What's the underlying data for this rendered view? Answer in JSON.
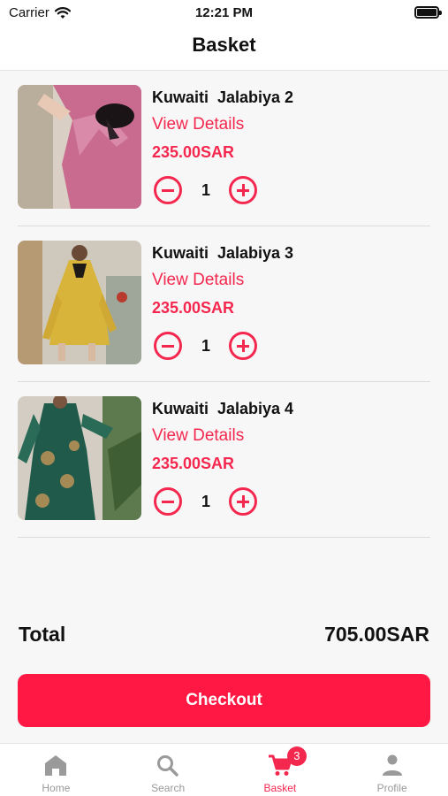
{
  "status_bar": {
    "carrier": "Carrier",
    "time": "12:21 PM"
  },
  "header": {
    "title": "Basket"
  },
  "items": [
    {
      "name": "Kuwaiti  Jalabiya 2",
      "details_label": "View Details",
      "price": "235.00SAR",
      "quantity": "1",
      "image_icon": "pink-dress-photo"
    },
    {
      "name": "Kuwaiti  Jalabiya 3",
      "details_label": "View Details",
      "price": "235.00SAR",
      "quantity": "1",
      "image_icon": "yellow-dress-photo"
    },
    {
      "name": "Kuwaiti  Jalabiya 4",
      "details_label": "View Details",
      "price": "235.00SAR",
      "quantity": "1",
      "image_icon": "green-dress-photo"
    }
  ],
  "summary": {
    "total_label": "Total",
    "total_value": "705.00SAR"
  },
  "checkout": {
    "label": "Checkout"
  },
  "tabs": [
    {
      "label": "Home",
      "icon": "home-icon"
    },
    {
      "label": "Search",
      "icon": "search-icon"
    },
    {
      "label": "Basket",
      "icon": "cart-icon",
      "badge": "3",
      "active": true
    },
    {
      "label": "Profile",
      "icon": "person-icon"
    }
  ],
  "colors": {
    "accent": "#f4284f",
    "checkout": "#fe1843",
    "inactive": "#9a9a9a"
  }
}
